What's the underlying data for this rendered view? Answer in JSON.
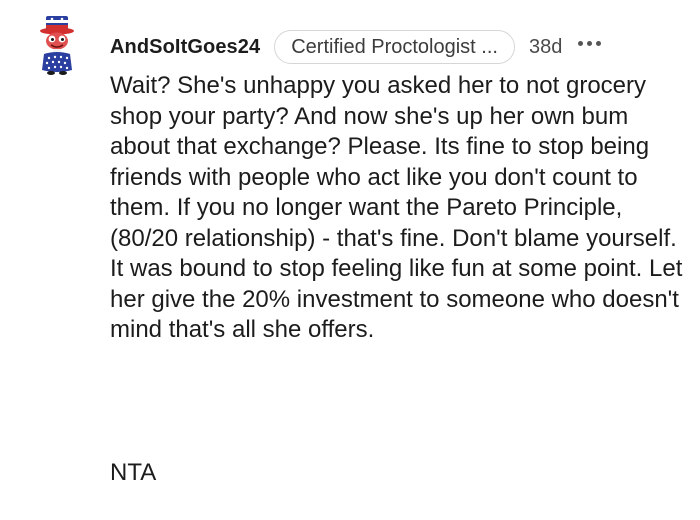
{
  "comment": {
    "username": "AndSoItGoes24",
    "flair": "Certified Proctologist ...",
    "age": "38d",
    "avatar_icon": "uncle-sam-avatar-icon",
    "more_icon": "more-options-icon",
    "body": "Wait? She's unhappy you asked her to not grocery shop your party? And now she's up her own bum about that exchange? Please. Its fine to stop being friends with people who act like you don't count to them. If you no longer want the Pareto Principle, (80/20 relationship) - that's fine. Don't blame yourself. It was bound to stop feeling like fun at some point. Let her give the 20% investment to someone who doesn't mind that's all she offers.",
    "verdict": "NTA"
  },
  "colors": {
    "text": "#1c1c1c",
    "flair_border": "#d6d6d6",
    "avatar_blue": "#2b3fa0",
    "avatar_red": "#d32f2f"
  }
}
